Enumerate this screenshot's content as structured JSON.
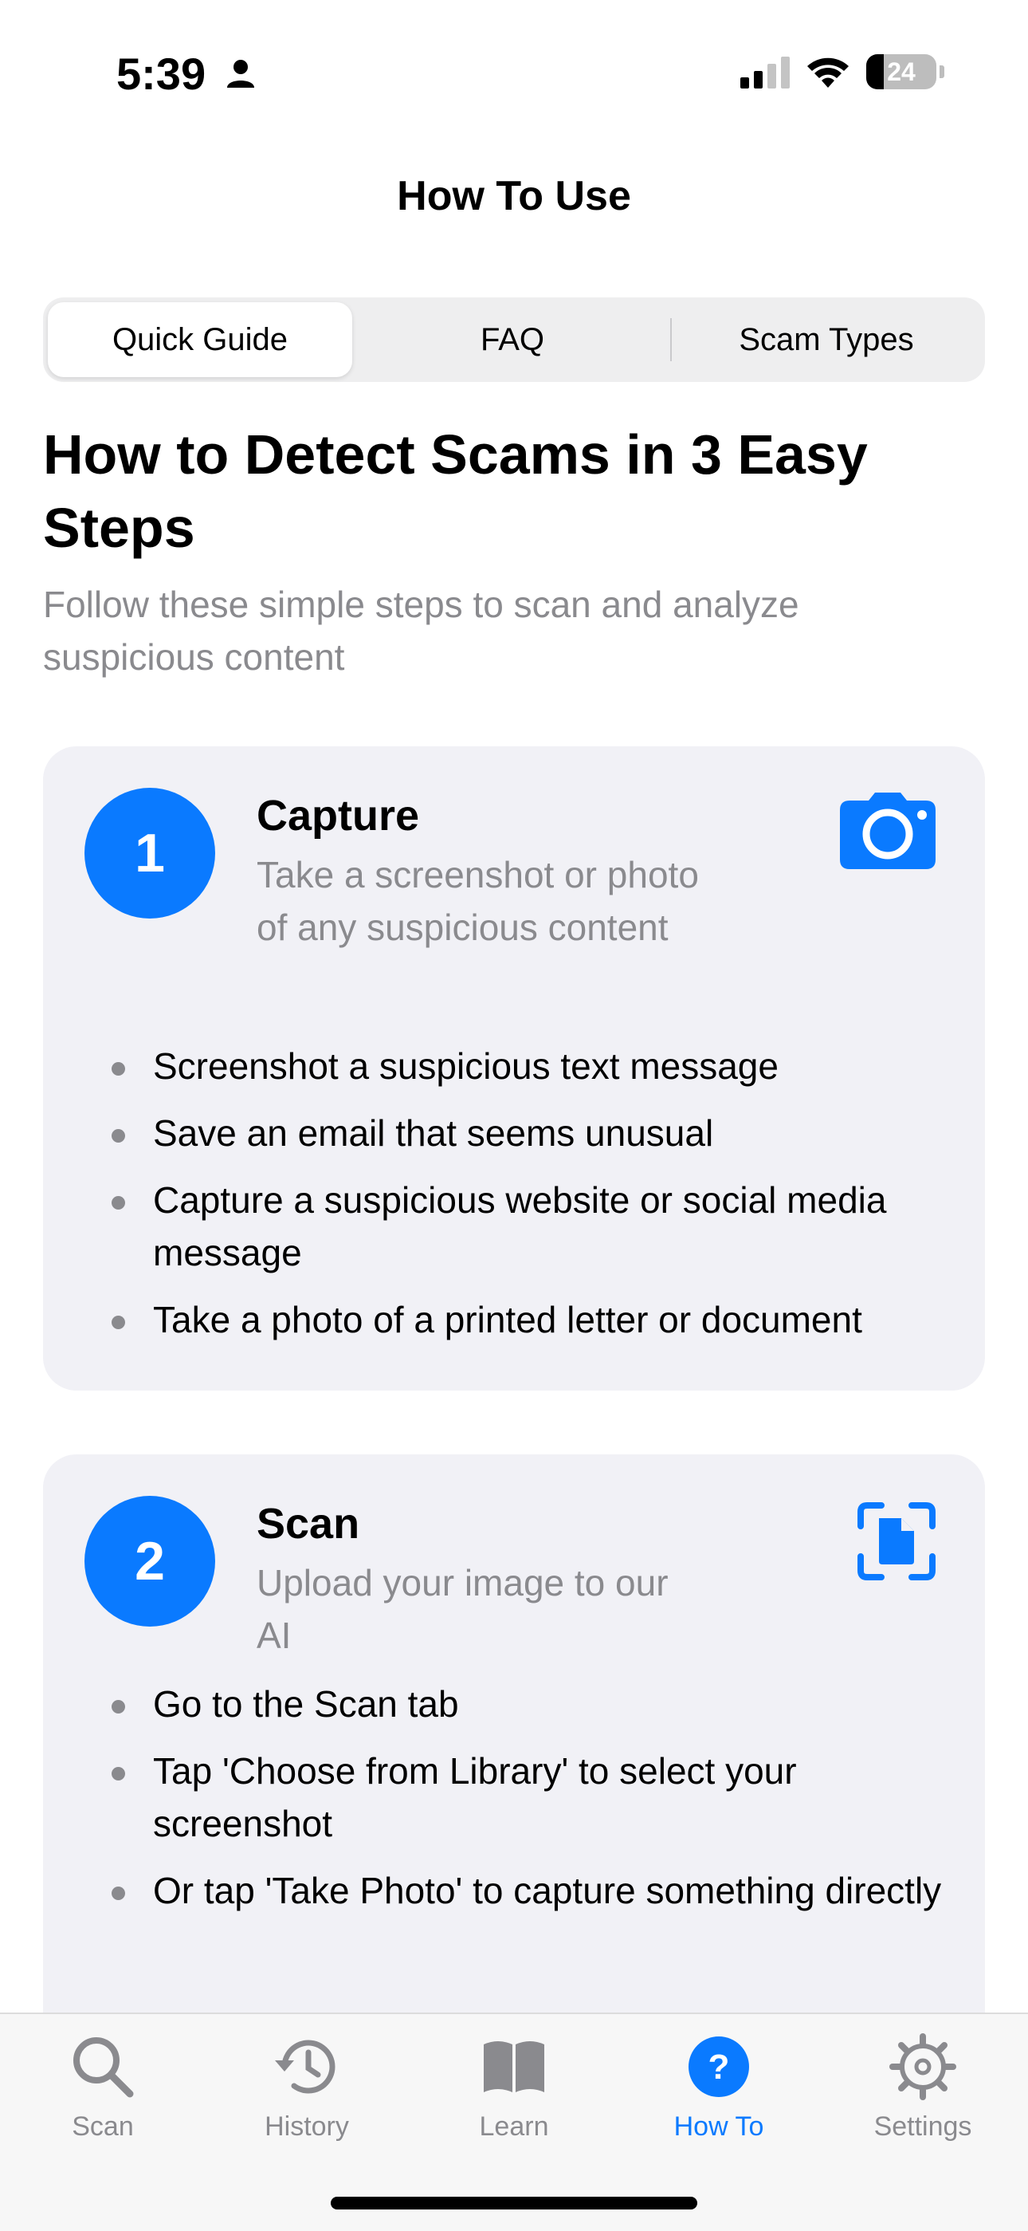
{
  "status_bar": {
    "time": "5:39",
    "battery": "24"
  },
  "nav": {
    "title": "How To Use"
  },
  "segments": {
    "quick_guide": "Quick Guide",
    "faq": "FAQ",
    "scam_types": "Scam Types"
  },
  "intro": {
    "title": "How to Detect Scams in 3 Easy Steps",
    "subtitle": "Follow these simple steps to scan and analyze suspicious content"
  },
  "steps": [
    {
      "number": "1",
      "title": "Capture",
      "description": "Take a screenshot or photo of any suspicious content",
      "icon": "camera-icon",
      "bullets": [
        "Screenshot a suspicious text message",
        "Save an email that seems unusual",
        "Capture a suspicious website or social media message",
        "Take a photo of a printed letter or document"
      ]
    },
    {
      "number": "2",
      "title": "Scan",
      "description": "Upload your image to our AI",
      "icon": "document-scan-icon",
      "bullets": [
        "Go to the Scan tab",
        "Tap 'Choose from Library' to select your screenshot",
        "Or tap 'Take Photo' to capture something directly"
      ]
    }
  ],
  "tabbar": {
    "scan": "Scan",
    "history": "History",
    "learn": "Learn",
    "how_to": "How To",
    "settings": "Settings"
  },
  "colors": {
    "accent": "#0a7aff",
    "card_bg": "#f1f1f6",
    "secondary_text": "#8a8a8e"
  }
}
